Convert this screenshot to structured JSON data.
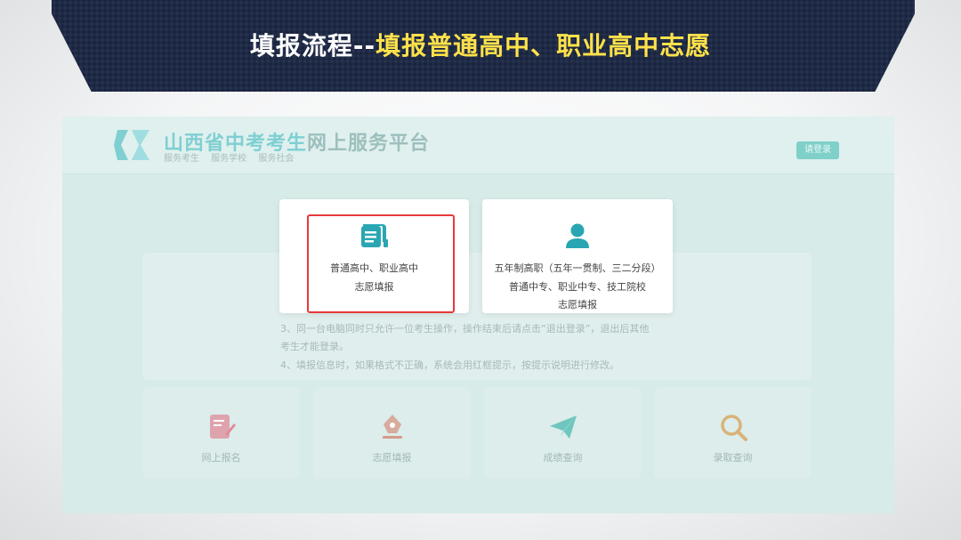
{
  "banner": {
    "title_part1": "填报流程--",
    "title_part2": "填报普通高中、职业高中志愿"
  },
  "site": {
    "title_accent": "山西省中考考生",
    "title_rest": "网上服务平台",
    "subtitle": "服务考生 服务学校 服务社会",
    "login_label": "请登录"
  },
  "cards": [
    {
      "icon": "document-icon",
      "lines": [
        "普通高中、职业高中",
        "志愿填报"
      ]
    },
    {
      "icon": "user-icon",
      "lines": [
        "五年制高职（五年一贯制、三二分段）",
        "普通中专、职业中专、技工院校",
        "志愿填报"
      ]
    }
  ],
  "notice": {
    "lines": [
      "3、同一台电脑同时只允许一位考生操作，操作结束后请点击“退出登录”，退出后其他",
      "考生才能登录。",
      "4、填报信息时，如果格式不正确，系统会用红框提示，按提示说明进行修改。"
    ]
  },
  "tiles": [
    {
      "icon": "edit-icon",
      "label": "网上报名",
      "color": "#e08a9a"
    },
    {
      "icon": "pen-nib-icon",
      "label": "志愿填报",
      "color": "#d69a8a"
    },
    {
      "icon": "paper-plane-icon",
      "label": "成绩查询",
      "color": "#6fc6bf"
    },
    {
      "icon": "magnifier-icon",
      "label": "录取查询",
      "color": "#d9b27a"
    }
  ],
  "colors": {
    "banner_bg": "#1f2a44",
    "title_yellow": "#ffe24a",
    "highlight_red": "#e53a3a",
    "teal": "#2aa6b3"
  }
}
